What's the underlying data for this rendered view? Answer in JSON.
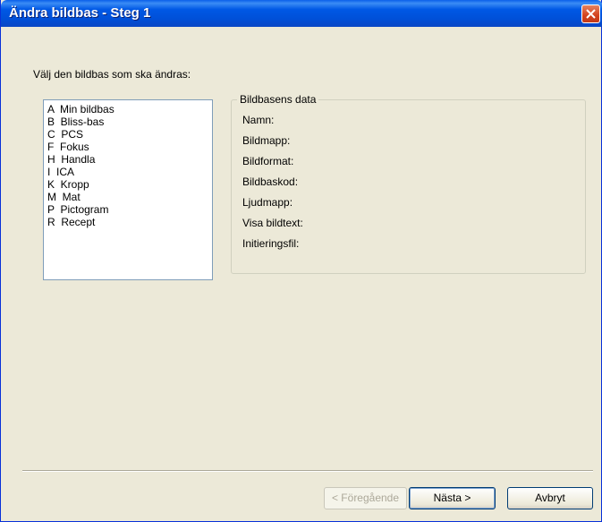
{
  "window": {
    "title": "Ändra bildbas - Steg 1"
  },
  "prompt": "Välj den bildbas som ska ändras:",
  "bases": [
    "A  Min bildbas",
    "B  Bliss-bas",
    "C  PCS",
    "F  Fokus",
    "H  Handla",
    "I  ICA",
    "K  Kropp",
    "M  Mat",
    "P  Pictogram",
    "R  Recept"
  ],
  "details": {
    "title": "Bildbasens data",
    "fields": [
      "Namn:",
      "Bildmapp:",
      "Bildformat:",
      "Bildbaskod:",
      "Ljudmapp:",
      "Visa bildtext:",
      "Initieringsfil:"
    ]
  },
  "buttons": {
    "back": "< Föregående",
    "next": "Nästa >",
    "cancel": "Avbryt"
  }
}
